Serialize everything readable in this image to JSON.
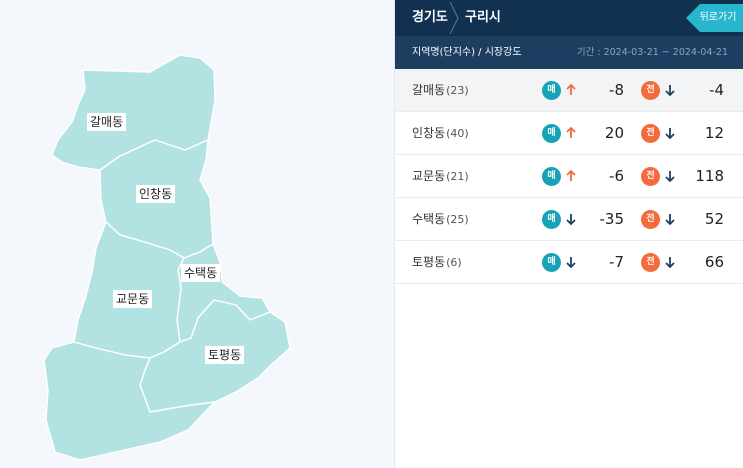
{
  "header": {
    "province": "경기도",
    "city": "구리시",
    "back_label": "뒤로가기"
  },
  "subheader": {
    "left": "지역명(단지수) / 시장강도",
    "right": "기간 : 2024-03-21 ~ 2024-04-21"
  },
  "badges": {
    "sale": "매",
    "jeon": "전"
  },
  "colors": {
    "header_bg": "#12304f",
    "subheader_bg": "#1d3e61",
    "back_button": "#28b6cf",
    "sale_badge": "#16a3b8",
    "jeon_badge": "#f26a3d",
    "up_arrow": "#f26a3d",
    "down_arrow": "#1d3e61",
    "map_fill": "#b3e2e3"
  },
  "rows": [
    {
      "name": "갈매동",
      "count": "(23)",
      "sale_dir": "up",
      "sale_value": "-8",
      "jeon_dir": "down",
      "jeon_value": "-4"
    },
    {
      "name": "인창동",
      "count": "(40)",
      "sale_dir": "up",
      "sale_value": "20",
      "jeon_dir": "down",
      "jeon_value": "12"
    },
    {
      "name": "교문동",
      "count": "(21)",
      "sale_dir": "up",
      "sale_value": "-6",
      "jeon_dir": "down",
      "jeon_value": "118"
    },
    {
      "name": "수택동",
      "count": "(25)",
      "sale_dir": "down",
      "sale_value": "-35",
      "jeon_dir": "down",
      "jeon_value": "52"
    },
    {
      "name": "토평동",
      "count": "(6)",
      "sale_dir": "down",
      "sale_value": "-7",
      "jeon_dir": "down",
      "jeon_value": "66"
    }
  ],
  "map_labels": {
    "galmae": "갈매동",
    "inchang": "인창동",
    "sutaek": "수택동",
    "gyomun": "교문동",
    "topyeong": "토평동"
  }
}
